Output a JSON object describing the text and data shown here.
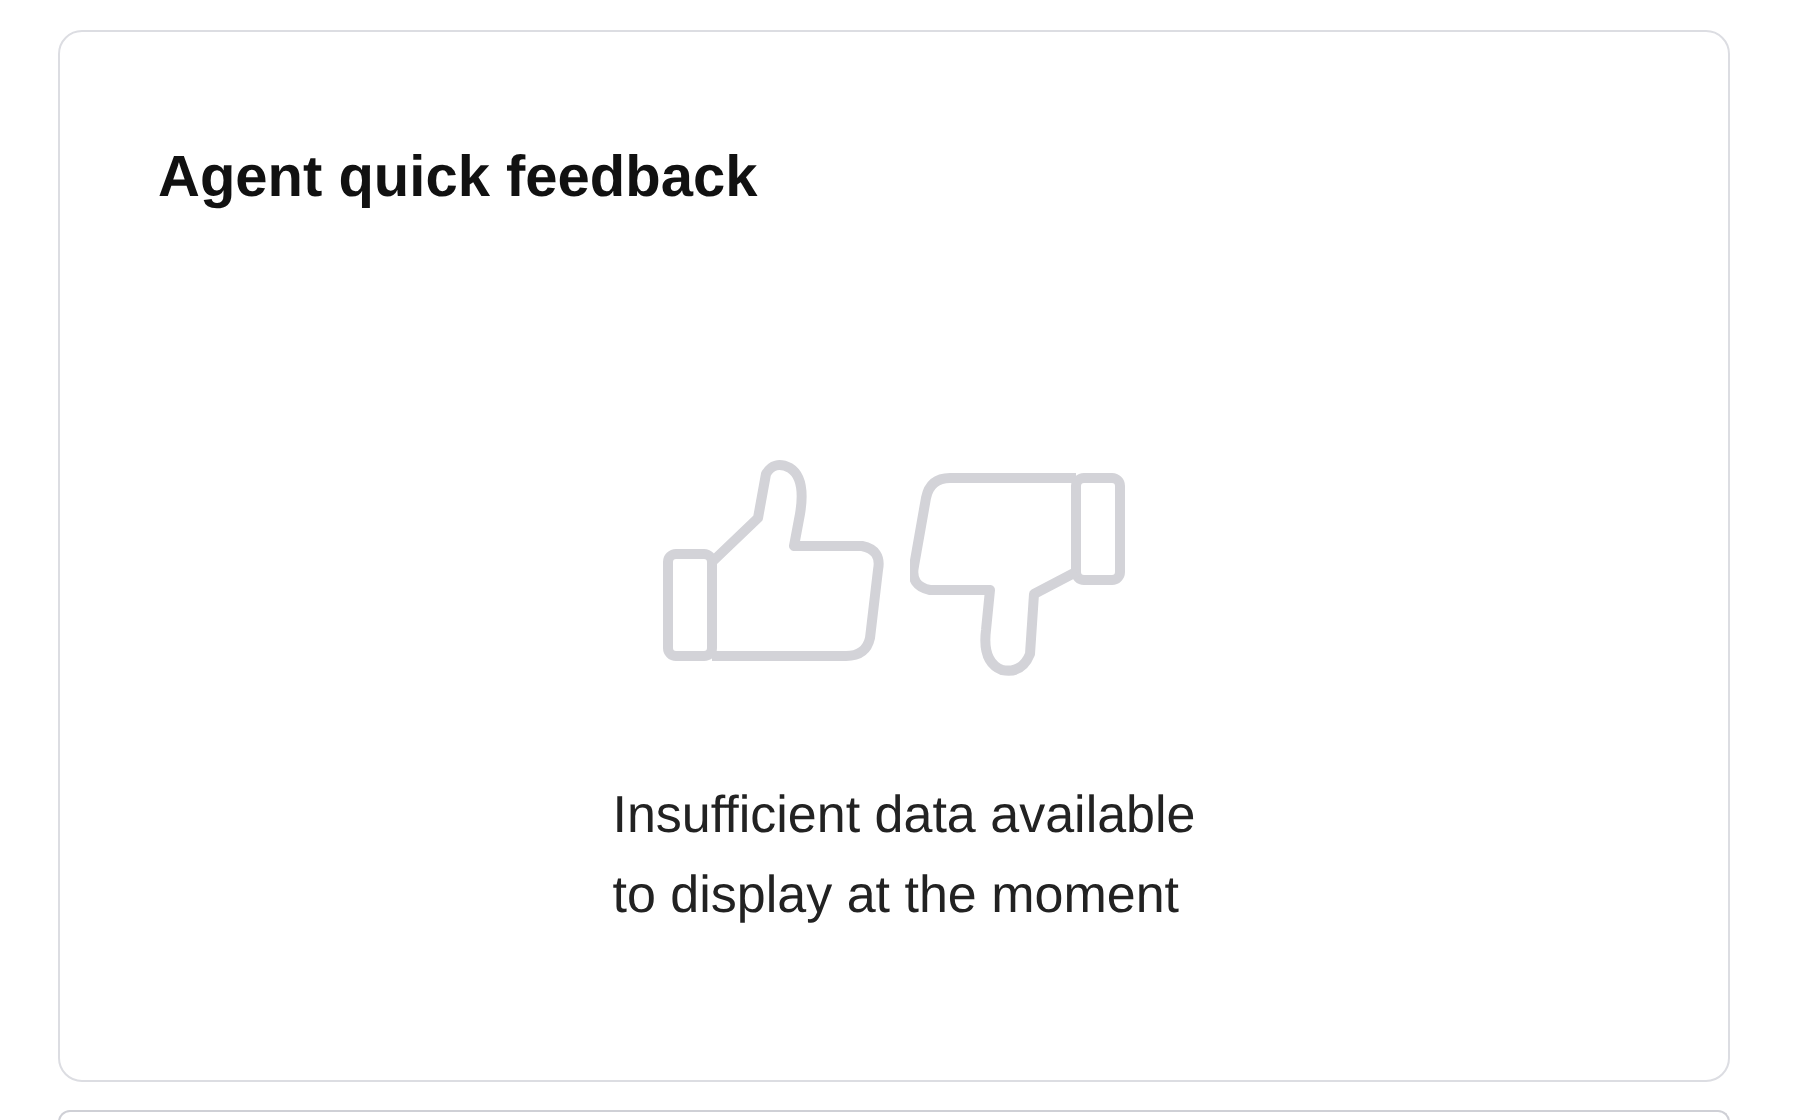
{
  "card": {
    "title": "Agent quick feedback",
    "empty_message": [
      "Insufficient data available",
      "to display at the moment"
    ]
  }
}
